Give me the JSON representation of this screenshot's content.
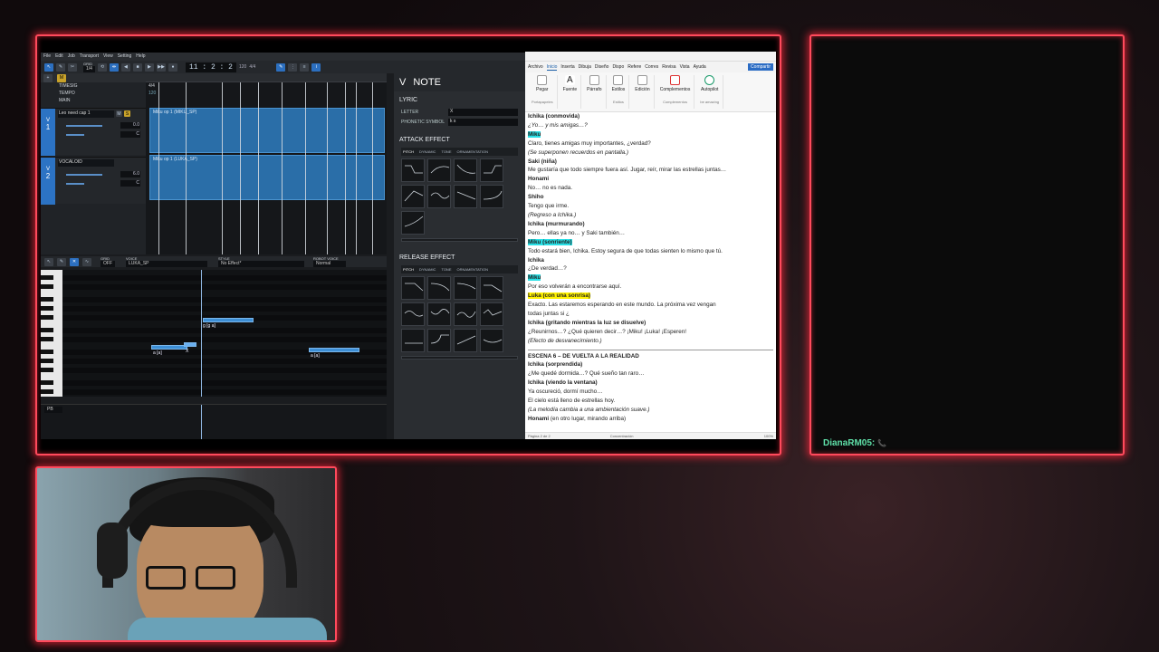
{
  "colors": {
    "frame": "#ff4a5c",
    "accent": "#2c73c4",
    "chat_user": "#5fe0a8"
  },
  "vocaloid": {
    "menu": [
      "File",
      "Edit",
      "Job",
      "Transport",
      "View",
      "Setting",
      "Help"
    ],
    "grid_label": "GRID",
    "grid_value": "1/4",
    "timecode": "11 : 2 : 2",
    "tempo_display": "120",
    "sig_display": "4/4",
    "rows": {
      "timesig": "TIMESIG",
      "tempo": "TEMPO",
      "main": "MAIN",
      "timesig_val": "4/4",
      "tempo_val": "120"
    },
    "tracks": [
      {
        "num": "1",
        "name": "Leo need cap 1",
        "field1": "0.0",
        "field2": "C",
        "part": "Miku op 1 (MIKU_SP)"
      },
      {
        "num": "2",
        "name": "VOCALOID",
        "field1": "6.0",
        "field2": "C",
        "part": "Miku op 1 (LUKA_SP)"
      }
    ],
    "piano_header": {
      "grid_label": "GRID",
      "grid_value": "OFF",
      "voice_label": "VOICE",
      "voice_value": "LUKA_SP",
      "style_label": "STYLE",
      "style_value": "No Effect*",
      "robot_label": "ROBOT VOICE",
      "robot_value": "Normal"
    },
    "notes": [
      {
        "label": "g [ɡ a]"
      },
      {
        "label": "a [a]"
      },
      {
        "label": "X"
      },
      {
        "label": "a [a]"
      }
    ],
    "pb_label": "PB",
    "note_panel": {
      "title": "NOTE",
      "lyric": "LYRIC",
      "letter_label": "LETTER",
      "letter_value": "X",
      "phonetic_label": "PHONETIC SYMBOL",
      "phonetic_value": "k s",
      "attack": "ATTACK EFFECT",
      "release": "RELEASE EFFECT",
      "tabs": [
        "PITCH",
        "DYNAMIC",
        "TONE",
        "ORNAMENTATION"
      ]
    }
  },
  "word": {
    "tabs": [
      "Archivo",
      "Inicio",
      "Inserta",
      "Dibuja",
      "Diseño",
      "Dispo",
      "Refere",
      "Corres",
      "Revisa",
      "Vista",
      "Ayuda"
    ],
    "share": "Compartir",
    "ribbon": [
      "Pegar",
      "Fuente",
      "Párrafo",
      "Estilos",
      "Edición",
      "Complementos",
      "Autopilot"
    ],
    "ribbon_groups": [
      "Portapapeles",
      "Estilos",
      "Complementos",
      "be amazing"
    ],
    "lines": [
      {
        "t": "Ichika (conmovida)",
        "s": "b"
      },
      {
        "t": "¿Yo… y mis amigas…?",
        "s": "i"
      },
      {
        "t": "Miku",
        "s": "b hl-cyan"
      },
      {
        "t": "Claro, tienes amigas muy importantes, ¿verdad?",
        "s": ""
      },
      {
        "t": "(Se superponen recuerdos en pantalla.)",
        "s": "i"
      },
      {
        "t": "Saki (niña)",
        "s": "b"
      },
      {
        "t": "Me gustaría que todo siempre fuera así. Jugar, reír, mirar las estrellas juntas…",
        "s": ""
      },
      {
        "t": "Honami",
        "s": "b"
      },
      {
        "t": "No… no es nada.",
        "s": ""
      },
      {
        "t": "Shiho",
        "s": "b"
      },
      {
        "t": "Tengo que irme.",
        "s": ""
      },
      {
        "t": "(Regreso a Ichika.)",
        "s": "i"
      },
      {
        "t": "Ichika (murmurando)",
        "s": "b"
      },
      {
        "t": "Pero… ellas ya no… y Saki también…",
        "s": ""
      },
      {
        "t": "Miku (sonriente)",
        "s": "b hl-cyan"
      },
      {
        "t": "Todo estará bien, Ichika. Estoy segura de que todas sienten lo mismo que tú.",
        "s": ""
      },
      {
        "t": "Ichika",
        "s": "b"
      },
      {
        "t": "¿De verdad…?",
        "s": ""
      },
      {
        "t": "Miku",
        "s": "b hl-cyan"
      },
      {
        "t": "Por eso volverán a encontrarse aquí.",
        "s": ""
      },
      {
        "t": "Luka (con una sonrisa)",
        "s": "b hl-yel"
      },
      {
        "t": "Exacto. Las estaremos esperando en este mundo. La próxima vez vengan",
        "s": ""
      },
      {
        "t": "todas juntas si ¿",
        "s": ""
      },
      {
        "t": "Ichika (gritando mientras la luz se disuelve)",
        "s": "b"
      },
      {
        "t": "¿Reunirnos…? ¿Qué quieren decir…? ¡Miku! ¡Luka! ¡Esperen!",
        "s": ""
      },
      {
        "t": "(Efecto de desvanecimiento.)",
        "s": "i"
      },
      {
        "t": "",
        "s": "hr"
      },
      {
        "t": "ESCENA 6 – DE VUELTA A LA REALIDAD",
        "s": "b"
      },
      {
        "t": "Ichika (sorprendida)",
        "s": "b"
      },
      {
        "t": "¿Me quedé dormida…? Qué sueño tan raro…",
        "s": ""
      },
      {
        "t": "Ichika (viendo la ventana)",
        "s": "b"
      },
      {
        "t": "Ya oscureció, dormí mucho…",
        "s": ""
      },
      {
        "t": "El cielo está lleno de estrellas hoy.",
        "s": ""
      },
      {
        "t": "(La melodía cambia a una ambientación suave.)",
        "s": "i"
      },
      {
        "t": "Honami (en otro lugar, mirando arriba)",
        "s": "b-first"
      }
    ],
    "status": [
      "Página 2 de 2",
      "Concentración",
      "100%"
    ]
  },
  "chat": {
    "username": "DianaRM05:",
    "message": "📞"
  }
}
